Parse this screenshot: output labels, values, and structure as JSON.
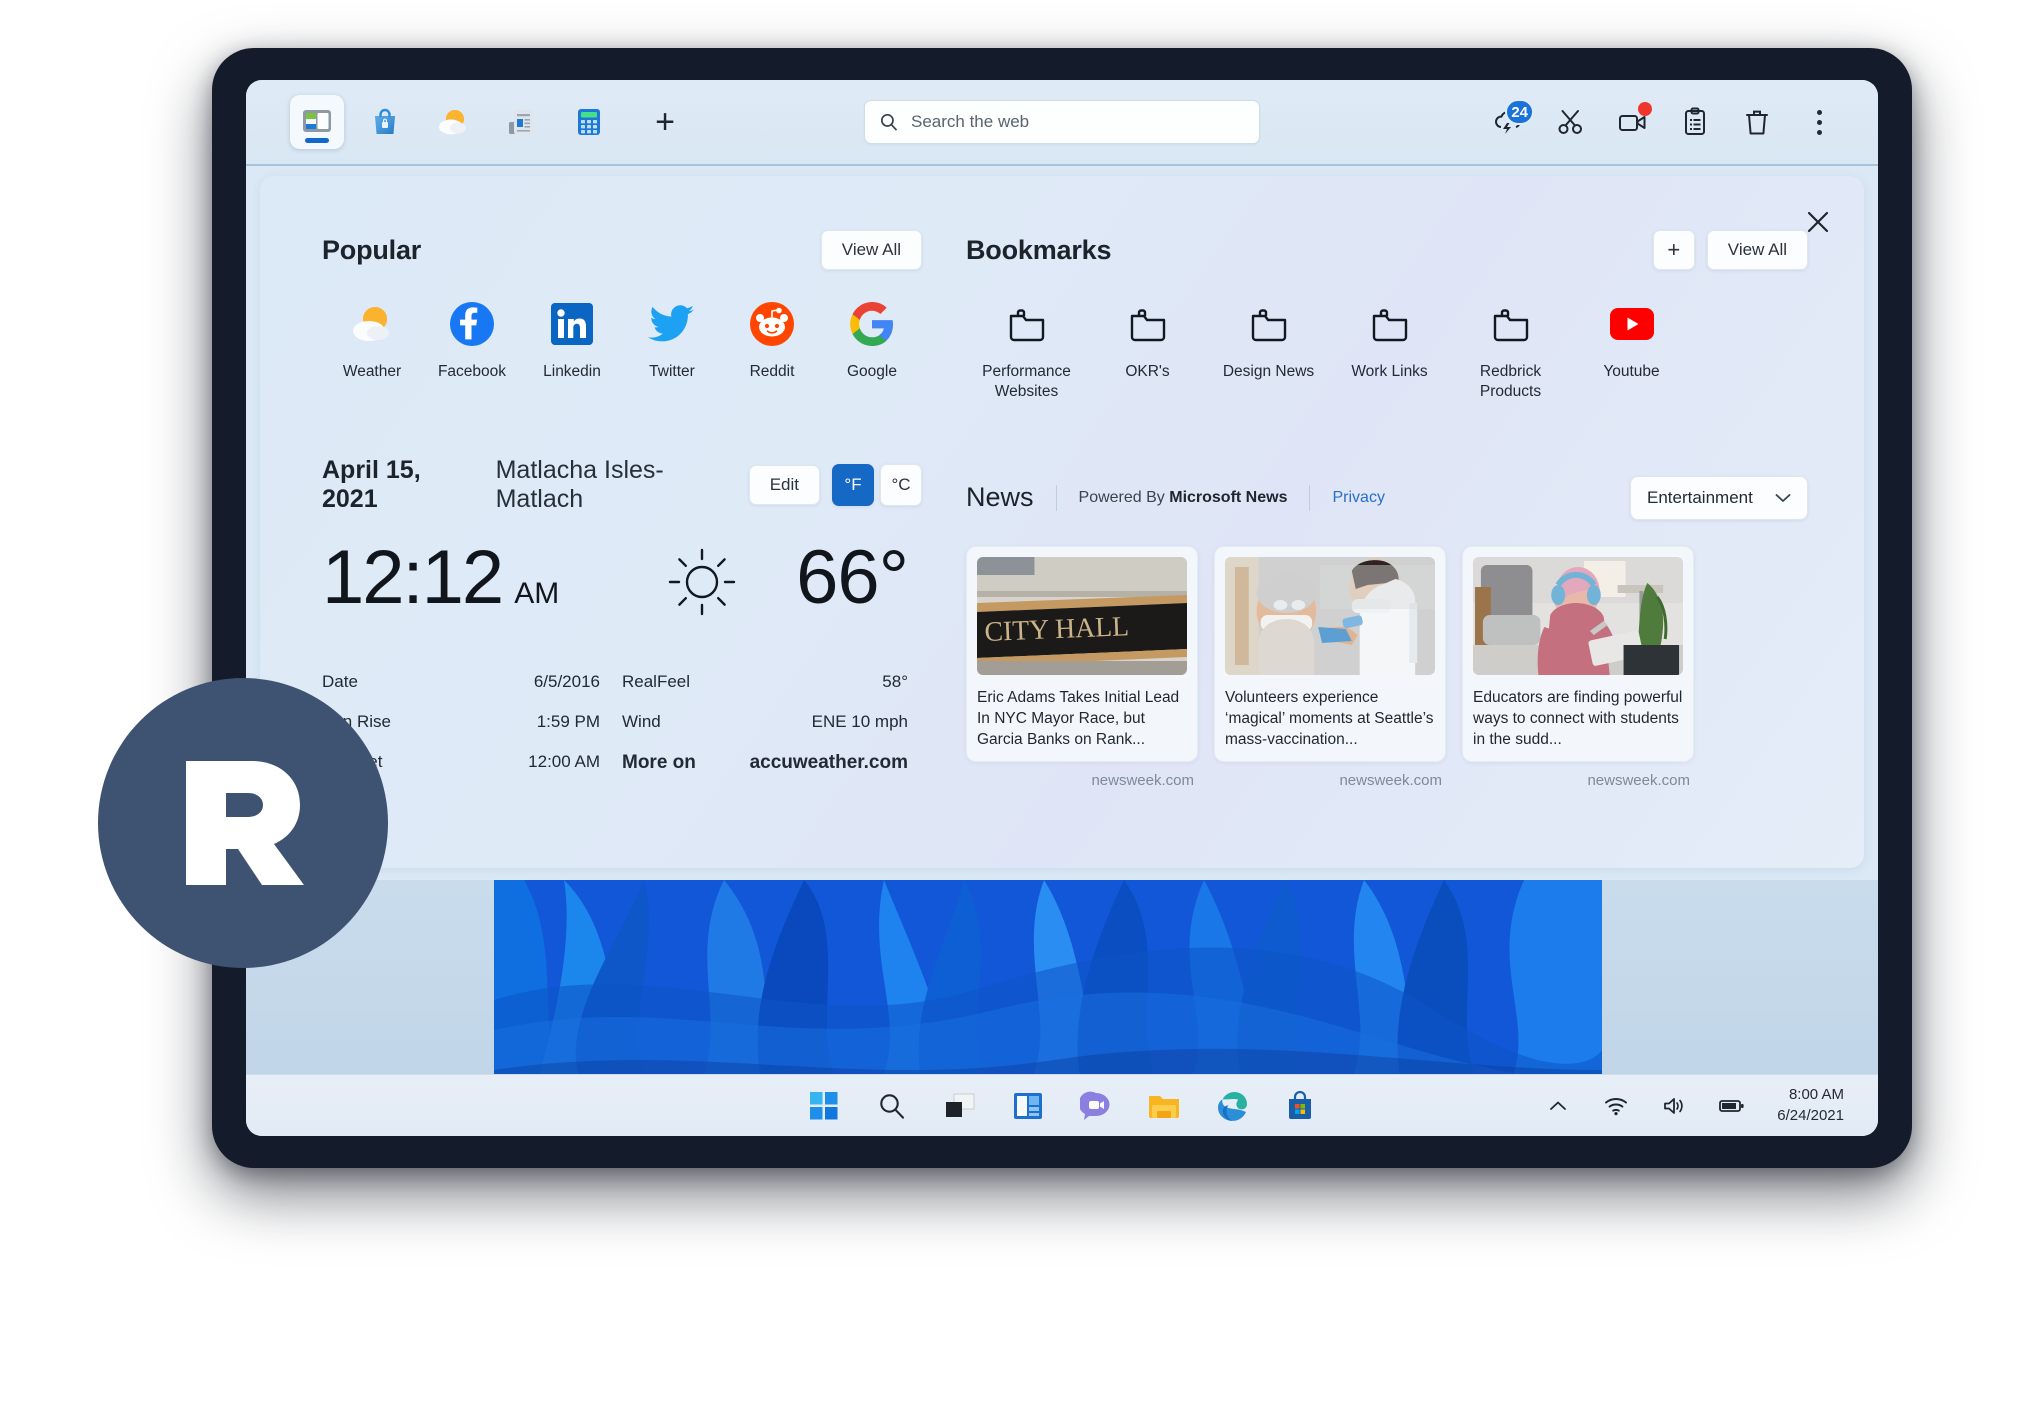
{
  "browser": {
    "tabs": [
      {
        "name": "split-screen-app",
        "icon": "split-screen-icon"
      },
      {
        "name": "store-bag",
        "icon": "shopping-bag-icon"
      },
      {
        "name": "weather-app",
        "icon": "weather-sun-cloud-icon"
      },
      {
        "name": "news-reader",
        "icon": "news-reader-icon"
      },
      {
        "name": "calculator",
        "icon": "calculator-icon"
      }
    ],
    "new_tab_label": "+",
    "search": {
      "placeholder": "Search the web",
      "value": "",
      "icon": "search-icon"
    },
    "actions": [
      {
        "name": "sync-cloud-icon",
        "badge": "24"
      },
      {
        "name": "scissors-snip-icon",
        "badge": ""
      },
      {
        "name": "video-record-icon",
        "badge": "dot"
      },
      {
        "name": "clipboard-icon",
        "badge": ""
      },
      {
        "name": "trash-icon",
        "badge": ""
      },
      {
        "name": "more-options-icon",
        "badge": ""
      }
    ]
  },
  "panel": {
    "close_label": "×",
    "popular": {
      "title": "Popular",
      "view_all": "View All",
      "items": [
        {
          "label": "Weather",
          "icon": "weather-sun-cloud-icon"
        },
        {
          "label": "Facebook",
          "icon": "facebook-icon"
        },
        {
          "label": "Linkedin",
          "icon": "linkedin-icon"
        },
        {
          "label": "Twitter",
          "icon": "twitter-icon"
        },
        {
          "label": "Reddit",
          "icon": "reddit-icon"
        },
        {
          "label": "Google",
          "icon": "google-icon"
        }
      ]
    },
    "bookmarks": {
      "title": "Bookmarks",
      "add_label": "+",
      "view_all": "View All",
      "items": [
        {
          "label": "Performance Websites",
          "icon": "folder-icon"
        },
        {
          "label": "OKR's",
          "icon": "folder-icon"
        },
        {
          "label": "Design News",
          "icon": "folder-icon"
        },
        {
          "label": "Work Links",
          "icon": "folder-icon"
        },
        {
          "label": "Redbrick Products",
          "icon": "folder-icon"
        },
        {
          "label": "Youtube",
          "icon": "youtube-icon"
        }
      ]
    },
    "weather": {
      "date": "April 15, 2021",
      "location": "Matlacha Isles-Matlach",
      "edit_label": "Edit",
      "unit_f": "°F",
      "unit_c": "°C",
      "active_unit": "°F",
      "time": "12:12",
      "ampm": "AM",
      "condition_icon": "sun-icon",
      "temperature": "66°",
      "stats_left": [
        {
          "label": "Date",
          "value": "6/5/2016"
        },
        {
          "label": "Sun Rise",
          "value": "1:59 PM"
        },
        {
          "label": "Sun Set",
          "value": "12:00 AM"
        }
      ],
      "stats_right": [
        {
          "label": "RealFeel",
          "value": "58°"
        },
        {
          "label": "Wind",
          "value": "ENE 10 mph"
        },
        {
          "label": "More on",
          "value": "accuweather.com"
        }
      ]
    },
    "news": {
      "title": "News",
      "powered_prefix": "Powered By",
      "powered_brand": "Microsoft News",
      "privacy": "Privacy",
      "category": "Entertainment",
      "cards": [
        {
          "title": "Eric Adams Takes Initial Lead In NYC Mayor Race, but Garcia Banks on Rank...",
          "source": "newsweek.com",
          "image": "city-hall-sign-photo"
        },
        {
          "title": "Volunteers experience ‘magical’ moments at Seattle’s mass-vaccination...",
          "source": "newsweek.com",
          "image": "vaccination-clinic-photo"
        },
        {
          "title": "Educators are finding powerful ways to connect with students in the sudd...",
          "source": "newsweek.com",
          "image": "student-tablet-photo"
        }
      ]
    }
  },
  "taskbar": {
    "icons": [
      {
        "name": "windows-start-icon"
      },
      {
        "name": "search-icon"
      },
      {
        "name": "task-view-icon"
      },
      {
        "name": "widgets-icon"
      },
      {
        "name": "chat-teams-icon"
      },
      {
        "name": "file-explorer-icon"
      },
      {
        "name": "edge-browser-icon"
      },
      {
        "name": "microsoft-store-icon"
      }
    ],
    "tray": [
      {
        "name": "chevron-up-icon"
      },
      {
        "name": "wifi-icon"
      },
      {
        "name": "volume-icon"
      },
      {
        "name": "battery-icon"
      }
    ],
    "time": "8:00 AM",
    "date": "6/24/2021"
  },
  "brand": {
    "logo_name": "redbrick-logo",
    "logo_color": "#3e5271"
  },
  "colors": {
    "accent_blue": "#1568c4",
    "badge_blue": "#1a73d8",
    "alert_red": "#f0352b",
    "panel_bg": "#dfeaf7",
    "frame_dark": "#141b2a"
  }
}
